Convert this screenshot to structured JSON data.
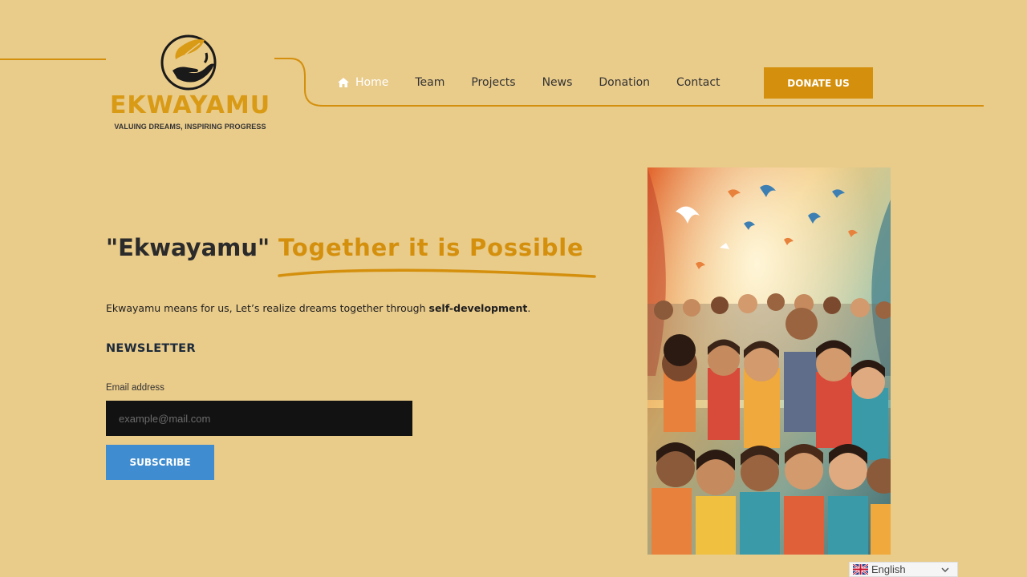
{
  "brand": {
    "name": "EKWAYAMU",
    "tagline": "VALUING DREAMS, INSPIRING PROGRESS"
  },
  "nav": {
    "items": [
      {
        "label": "Home",
        "icon": "home-icon",
        "active": true
      },
      {
        "label": "Team"
      },
      {
        "label": "Projects"
      },
      {
        "label": "News"
      },
      {
        "label": "Donation"
      },
      {
        "label": "Contact"
      }
    ],
    "donate_label": "DONATE US"
  },
  "hero": {
    "title": "\"Ekwayamu\"",
    "highlight": "Together it is Possible",
    "intro_text": "Ekwayamu means for us, Let’s realize dreams together through ",
    "intro_bold": "self-development",
    "intro_end": "."
  },
  "newsletter": {
    "title": "NEWSLETTER",
    "email_label": "Email address",
    "email_placeholder": "example@mail.com",
    "email_value": "",
    "subscribe_label": "SUBSCRIBE"
  },
  "language": {
    "selected": "English",
    "flag_icon": "uk-flag-icon"
  },
  "colors": {
    "background": "#e9cb8a",
    "accent": "#d4900d",
    "subscribe": "#3f8dd0",
    "input_bg": "#121212"
  }
}
